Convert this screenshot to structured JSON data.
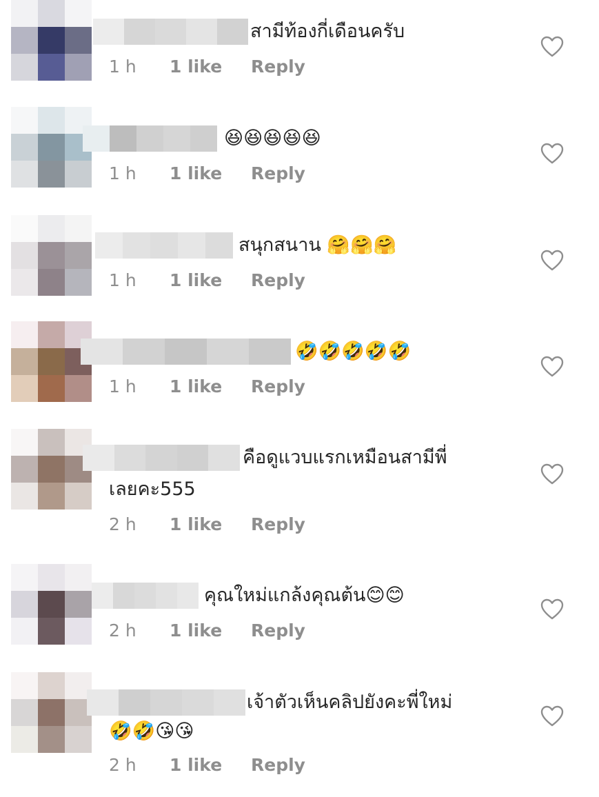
{
  "comments": [
    {
      "text": "สามีท้องกี่เดือนครับ",
      "text_line2": "",
      "time": "1 h",
      "likes": "1 like",
      "reply": "Reply",
      "avatar_colors": [
        "#f2f2f4",
        "#d9d9e0",
        "#f4f4f6",
        "#b5b5c3",
        "#353a66",
        "#6b6d86",
        "#d6d6dc",
        "#575c94",
        "#a0a0b4"
      ],
      "name_colors": [
        "#ececec",
        "#d6d6d6",
        "#dadada",
        "#e4e4e4",
        "#d2d2d2"
      ]
    },
    {
      "text": "😆😆😆😆😆",
      "text_line2": "",
      "time": "1 h",
      "likes": "1 like",
      "reply": "Reply",
      "avatar_colors": [
        "#f6f7f8",
        "#dde6ea",
        "#eef2f4",
        "#c9d1d6",
        "#8396a1",
        "#a9bfca",
        "#dfe1e3",
        "#8a9299",
        "#c8cdd1"
      ],
      "name_colors": [
        "#e8eef0",
        "#bdbdbd",
        "#d0d0d0",
        "#d6d6d6",
        "#cfcfcf"
      ]
    },
    {
      "text": "สนุกสนาน 🤗🤗🤗",
      "text_line2": "",
      "time": "1 h",
      "likes": "1 like",
      "reply": "Reply",
      "avatar_colors": [
        "#fafafa",
        "#ececee",
        "#f4f4f4",
        "#e3e0e2",
        "#9b9197",
        "#aaa5a9",
        "#ebe8ea",
        "#8e8289",
        "#b5b5bc"
      ],
      "name_colors": [
        "#ececec",
        "#e2e2e2",
        "#dedede",
        "#e6e6e6",
        "#dcdcdc"
      ]
    },
    {
      "text": "🤣🤣🤣🤣🤣",
      "text_line2": "",
      "time": "1 h",
      "likes": "1 like",
      "reply": "Reply",
      "avatar_colors": [
        "#f6eef0",
        "#c5aaa8",
        "#ded0d6",
        "#c5b09b",
        "#8a6a4a",
        "#7d5f5d",
        "#e2cdb9",
        "#a06a4c",
        "#b18e88"
      ],
      "name_colors": [
        "#e4e4e4",
        "#d2d2d2",
        "#c6c6c6",
        "#d6d6d6",
        "#cacaca"
      ]
    },
    {
      "text": "คือดูแวบแรกเหมือนสามีพี่",
      "text_line2": "เลยคะ555",
      "time": "2 h",
      "likes": "1 like",
      "reply": "Reply",
      "avatar_colors": [
        "#f8f6f6",
        "#c9c0bd",
        "#ebe6e4",
        "#bdb2b0",
        "#8f7465",
        "#9e8b84",
        "#eae6e4",
        "#b0998a",
        "#d6ccc6"
      ],
      "name_colors": [
        "#eaeaea",
        "#dcdcdc",
        "#d4d4d4",
        "#d0d0d0",
        "#e0e0e0"
      ]
    },
    {
      "text": "คุณใหม่แกล้งคุณต้น😊😊",
      "text_line2": "",
      "time": "2 h",
      "likes": "1 like",
      "reply": "Reply",
      "avatar_colors": [
        "#f5f4f6",
        "#e8e5ea",
        "#f2f0f2",
        "#d7d5dc",
        "#5c4a4e",
        "#a9a3a8",
        "#f2f1f4",
        "#6c5a5f",
        "#e6e2ea"
      ],
      "name_colors": [
        "#ececec",
        "#d8d8d8",
        "#dcdcdc",
        "#e2e2e2",
        "#e8e8e8"
      ]
    },
    {
      "text": "เจ้าตัวเห็นคลิปยังคะพี่ใหม่",
      "text_line2": "🤣🤣😘😘",
      "time": "2 h",
      "likes": "1 like",
      "reply": "Reply",
      "avatar_colors": [
        "#f8f4f4",
        "#ddd3cf",
        "#f2eeee",
        "#d8d6d6",
        "#8d7268",
        "#c9c0bc",
        "#ecebe6",
        "#a39088",
        "#d8d2d0"
      ],
      "name_colors": [
        "#e8e8e8",
        "#cfcfcf",
        "#d6d6d6",
        "#dadada",
        "#e0e0e0"
      ]
    }
  ]
}
